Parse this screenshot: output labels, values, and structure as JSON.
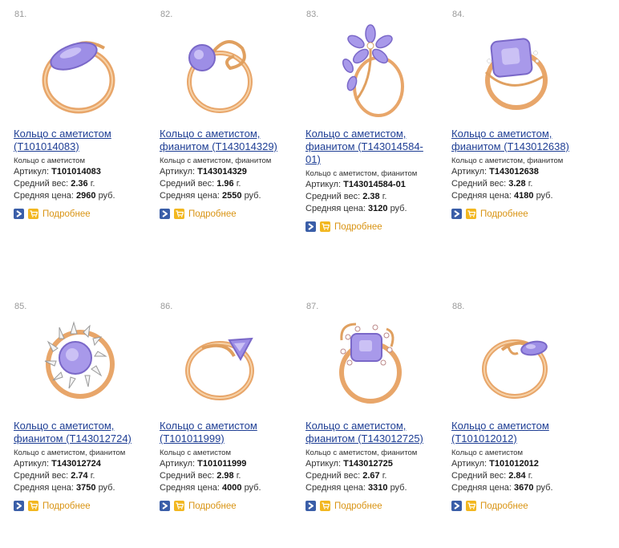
{
  "products": [
    {
      "num": "81.",
      "title": "Кольцо с аметистом (Т101014083)",
      "desc": "Кольцо с аметистом",
      "sku_label": "Артикул:",
      "sku": "Т101014083",
      "weight_label": "Средний вес:",
      "weight": "2.36",
      "weight_unit": "г.",
      "price_label": "Средняя цена:",
      "price": "2960",
      "price_unit": "руб.",
      "more": "Подробнее"
    },
    {
      "num": "82.",
      "title": "Кольцо с аметистом, фианитом (Т143014329)",
      "desc": "Кольцо с аметистом, фианитом",
      "sku_label": "Артикул:",
      "sku": "Т143014329",
      "weight_label": "Средний вес:",
      "weight": "1.96",
      "weight_unit": "г.",
      "price_label": "Средняя цена:",
      "price": "2550",
      "price_unit": "руб.",
      "more": "Подробнее"
    },
    {
      "num": "83.",
      "title": "Кольцо с аметистом, фианитом (Т143014584-01)",
      "desc": "Кольцо с аметистом, фианитом",
      "sku_label": "Артикул:",
      "sku": "Т143014584-01",
      "weight_label": "Средний вес:",
      "weight": "2.38",
      "weight_unit": "г.",
      "price_label": "Средняя цена:",
      "price": "3120",
      "price_unit": "руб.",
      "more": "Подробнее"
    },
    {
      "num": "84.",
      "title": "Кольцо с аметистом, фианитом (Т143012638)",
      "desc": "Кольцо с аметистом, фианитом",
      "sku_label": "Артикул:",
      "sku": "Т143012638",
      "weight_label": "Средний вес:",
      "weight": "3.28",
      "weight_unit": "г.",
      "price_label": "Средняя цена:",
      "price": "4180",
      "price_unit": "руб.",
      "more": "Подробнее"
    },
    {
      "num": "85.",
      "title": "Кольцо с аметистом, фианитом (Т143012724)",
      "desc": "Кольцо с аметистом, фианитом",
      "sku_label": "Артикул:",
      "sku": "Т143012724",
      "weight_label": "Средний вес:",
      "weight": "2.74",
      "weight_unit": "г.",
      "price_label": "Средняя цена:",
      "price": "3750",
      "price_unit": "руб.",
      "more": "Подробнее"
    },
    {
      "num": "86.",
      "title": "Кольцо с аметистом (Т101011999)",
      "desc": "Кольцо с аметистом",
      "sku_label": "Артикул:",
      "sku": "Т101011999",
      "weight_label": "Средний вес:",
      "weight": "2.98",
      "weight_unit": "г.",
      "price_label": "Средняя цена:",
      "price": "4000",
      "price_unit": "руб.",
      "more": "Подробнее"
    },
    {
      "num": "87.",
      "title": "Кольцо с аметистом, фианитом (Т143012725)",
      "desc": "Кольцо с аметистом, фианитом",
      "sku_label": "Артикул:",
      "sku": "Т143012725",
      "weight_label": "Средний вес:",
      "weight": "2.67",
      "weight_unit": "г.",
      "price_label": "Средняя цена:",
      "price": "3310",
      "price_unit": "руб.",
      "more": "Подробнее"
    },
    {
      "num": "88.",
      "title": "Кольцо с аметистом (Т101012012)",
      "desc": "Кольцо с аметистом",
      "sku_label": "Артикул:",
      "sku": "Т101012012",
      "weight_label": "Средний вес:",
      "weight": "2.84",
      "weight_unit": "г.",
      "price_label": "Средняя цена:",
      "price": "3670",
      "price_unit": "руб.",
      "more": "Подробнее"
    }
  ],
  "colors": {
    "link": "#1f3f95",
    "more": "#d99414",
    "arrow_btn": "#3a5ea8",
    "cart_btn": "#f2b720",
    "gold": "#e0a060",
    "amethyst": "#9d8ee6"
  },
  "icons": {
    "detail": "arrow-right-icon",
    "cart": "cart-icon"
  }
}
